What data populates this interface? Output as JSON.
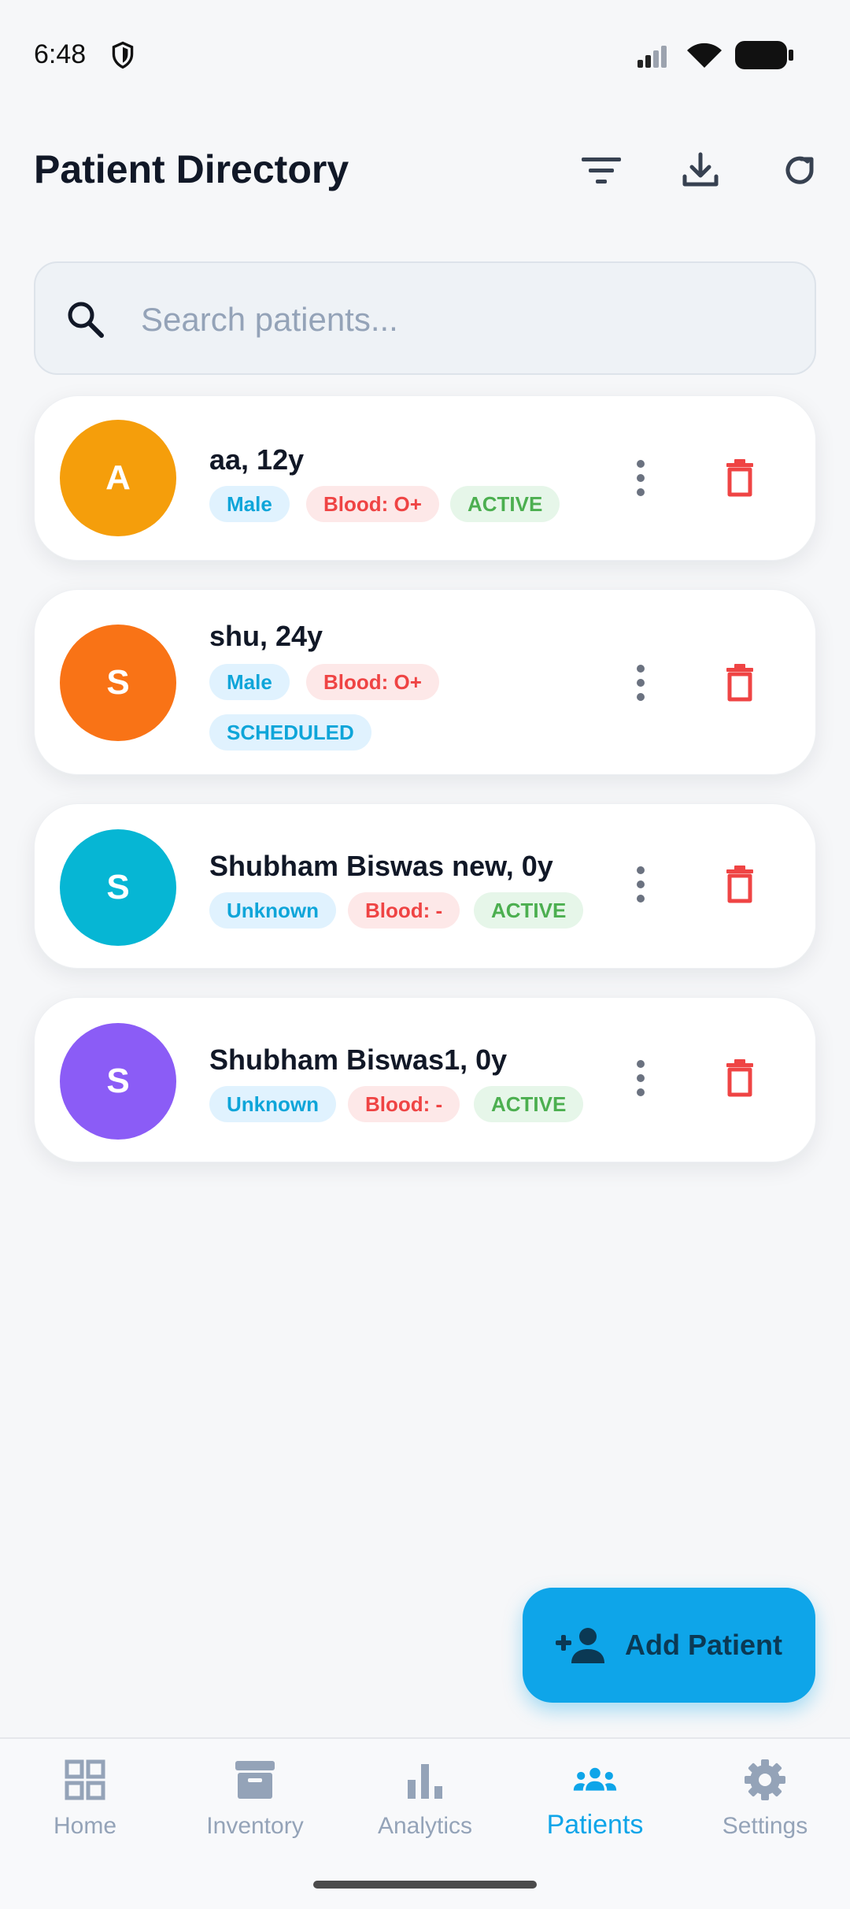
{
  "status_bar": {
    "time": "6:48"
  },
  "header": {
    "title": "Patient Directory"
  },
  "search": {
    "placeholder": "Search patients...",
    "value": ""
  },
  "patients": [
    {
      "initial": "A",
      "name": "aa, 12y",
      "gender": "Male",
      "blood": "Blood: O+",
      "status": "ACTIVE",
      "avatar_color": "#f59e0b"
    },
    {
      "initial": "S",
      "name": "shu, 24y",
      "gender": "Male",
      "blood": "Blood: O+",
      "status": "SCHEDULED",
      "avatar_color": "#f97316"
    },
    {
      "initial": "S",
      "name": "Shubham Biswas new, 0y",
      "gender": "Unknown",
      "blood": "Blood: -",
      "status": "ACTIVE",
      "avatar_color": "#06b6d4"
    },
    {
      "initial": "S",
      "name": "Shubham Biswas1, 0y",
      "gender": "Unknown",
      "blood": "Blood: -",
      "status": "ACTIVE",
      "avatar_color": "#8b5cf6"
    }
  ],
  "fab": {
    "label": "Add Patient"
  },
  "nav": {
    "items": [
      {
        "label": "Home",
        "icon": "grid-icon"
      },
      {
        "label": "Inventory",
        "icon": "archive-icon"
      },
      {
        "label": "Analytics",
        "icon": "bar-chart-icon"
      },
      {
        "label": "Patients",
        "icon": "people-icon"
      },
      {
        "label": "Settings",
        "icon": "gear-icon"
      }
    ],
    "active": "Patients"
  },
  "colors": {
    "accent": "#0ea5e9",
    "danger": "#ef4444",
    "success": "#4caf50",
    "muted": "#94a3b8"
  }
}
